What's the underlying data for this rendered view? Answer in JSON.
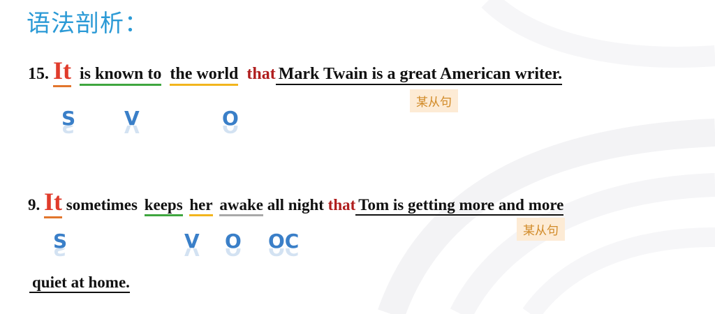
{
  "title": "语法剖析：",
  "clause_tag": "某从句",
  "sentence1": {
    "num": "15.",
    "subject": "It",
    "verb": "is known to",
    "object": "the world",
    "that": "that",
    "clause": "Mark Twain is a great American writer."
  },
  "sentence2": {
    "num": "9.",
    "subject": "It",
    "w1": "sometimes",
    "verb": "keeps",
    "object": "her",
    "oc": "awake",
    "w2": "all night",
    "that": "that",
    "clause": "Tom is getting more and more",
    "continuation": "quiet at home."
  },
  "roles": {
    "s": "S",
    "v": "V",
    "o": "O",
    "oc": "OC"
  }
}
